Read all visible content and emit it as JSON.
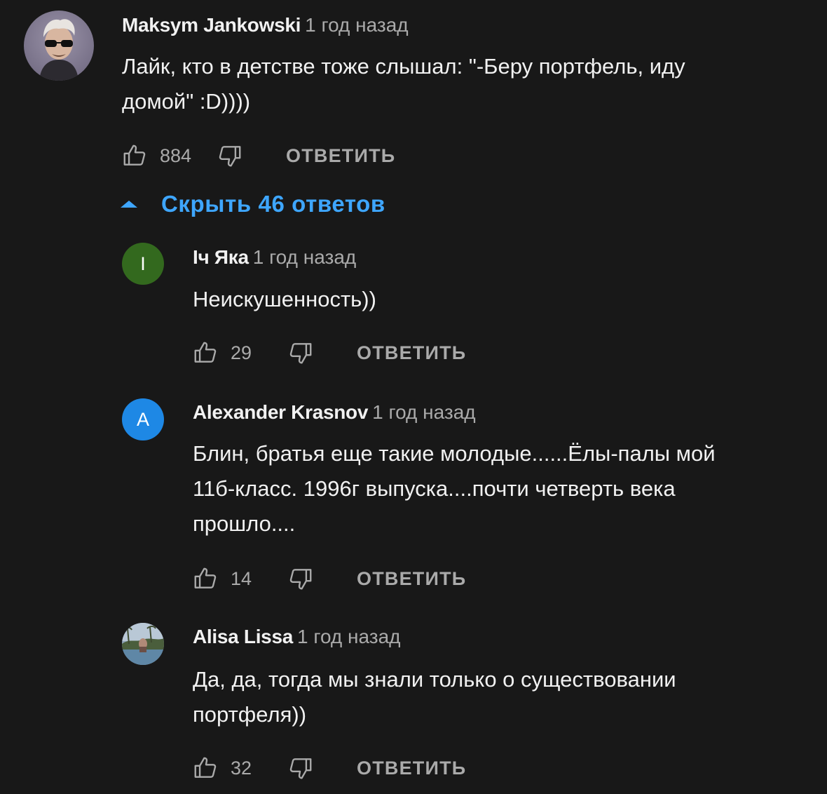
{
  "comments": [
    {
      "author": "Maksym Jankowski",
      "time": "1 год назад",
      "text_lines": [
        "Лайк, кто в детстве тоже слышал: \"-Беру портфель, иду",
        "домой\" :D))))"
      ],
      "likes": "884",
      "reply_label": "ОТВЕТИТЬ",
      "avatar_icon": "user-photo-avatar"
    }
  ],
  "toggle_replies": {
    "label": "Скрыть 46 ответов",
    "icon": "caret-up-icon",
    "color": "#3ea6ff"
  },
  "replies": [
    {
      "author": "Іч Яка",
      "time": "1 год назад",
      "text_lines": [
        "Неискушенность))"
      ],
      "likes": "29",
      "reply_label": "ОТВЕТИТЬ",
      "avatar_letter": "I",
      "avatar_color": "#33691e"
    },
    {
      "author": "Alexander Krasnov",
      "time": "1 год назад",
      "text_lines": [
        "Блин, братья еще такие молодые......Ёлы-палы мой",
        "11б-класс. 1996г выпуска....почти четверть века",
        "прошло...."
      ],
      "likes": "14",
      "reply_label": "ОТВЕТИТЬ",
      "avatar_letter": "A",
      "avatar_color": "#1e88e5"
    },
    {
      "author": "Alisa Lissa",
      "time": "1 год назад",
      "text_lines": [
        "Да, да, тогда мы знали только о существовании",
        "портфеля))"
      ],
      "likes": "32",
      "reply_label": "ОТВЕТИТЬ",
      "avatar_icon": "user-photo-avatar"
    }
  ],
  "colors": {
    "background": "#181818",
    "text_primary": "#f1f1f1",
    "text_secondary": "#aaaaaa",
    "accent": "#3ea6ff"
  }
}
